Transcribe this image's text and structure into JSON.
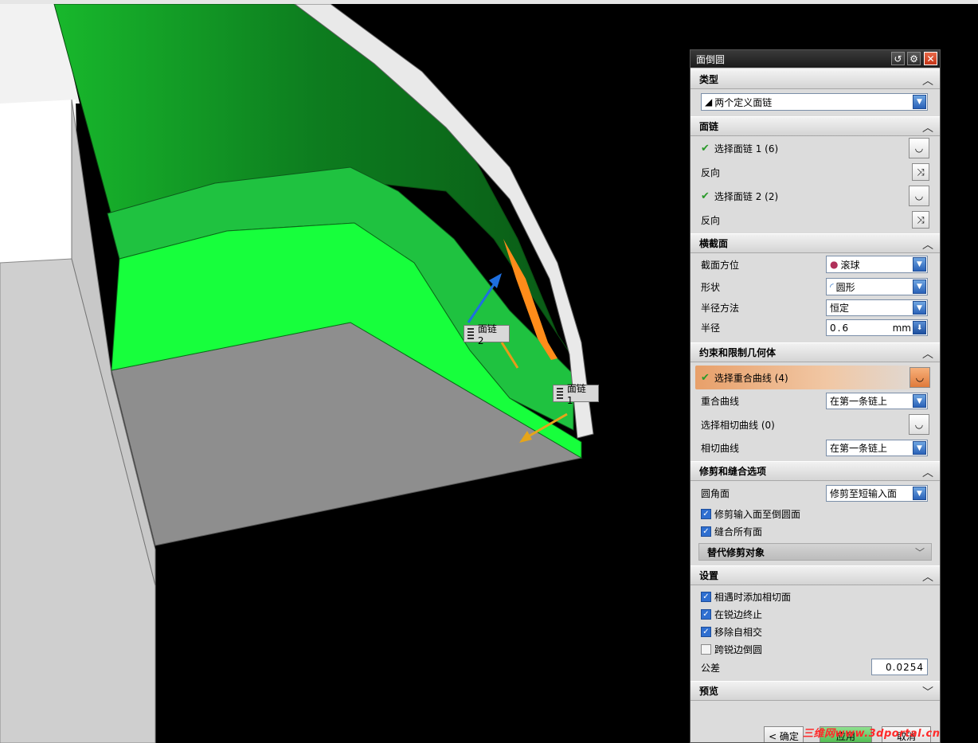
{
  "viewport": {
    "labels": {
      "chain2": "面链 2",
      "chain1": "面链 1"
    },
    "colors": {
      "face": "#17ff3c",
      "background": "#000000",
      "body": "#b4b4b4"
    }
  },
  "dialog": {
    "title": "面倒圆",
    "sections": {
      "type": {
        "header": "类型",
        "value": "两个定义面链"
      },
      "chain": {
        "header": "面链",
        "select1": "选择面链 1 (6)",
        "reverse1": "反向",
        "select2": "选择面链 2 (2)",
        "reverse2": "反向"
      },
      "cross": {
        "header": "横截面",
        "orient_label": "截面方位",
        "orient_value": "滚球",
        "shape_label": "形状",
        "shape_value": "圆形",
        "method_label": "半径方法",
        "method_value": "恒定",
        "radius_label": "半径",
        "radius_value": "0.6",
        "radius_unit": "mm"
      },
      "constraint": {
        "header": "约束和限制几何体",
        "select_coincident": "选择重合曲线 (4)",
        "coincident_label": "重合曲线",
        "coincident_value": "在第一条链上",
        "select_tangent": "选择相切曲线 (0)",
        "tangent_label": "相切曲线",
        "tangent_value": "在第一条链上"
      },
      "trim": {
        "header": "修剪和缝合选项",
        "fillet_label": "圆角面",
        "fillet_value": "修剪至短输入面",
        "cb_trim": "修剪输入面至倒圆面",
        "cb_sew": "缝合所有面",
        "sub": "替代修剪对象"
      },
      "settings": {
        "header": "设置",
        "cb1": "相遇时添加相切面",
        "cb2": "在锐边终止",
        "cb3": "移除自相交",
        "cb4": "跨锐边倒圆",
        "tol_label": "公差",
        "tol_value": "0.0254"
      },
      "preview": {
        "header": "预览"
      }
    },
    "buttons": {
      "ok": "< 确定",
      "apply": "应用",
      "cancel": "取消"
    }
  },
  "watermark": "三维网www.3dportal.cn"
}
